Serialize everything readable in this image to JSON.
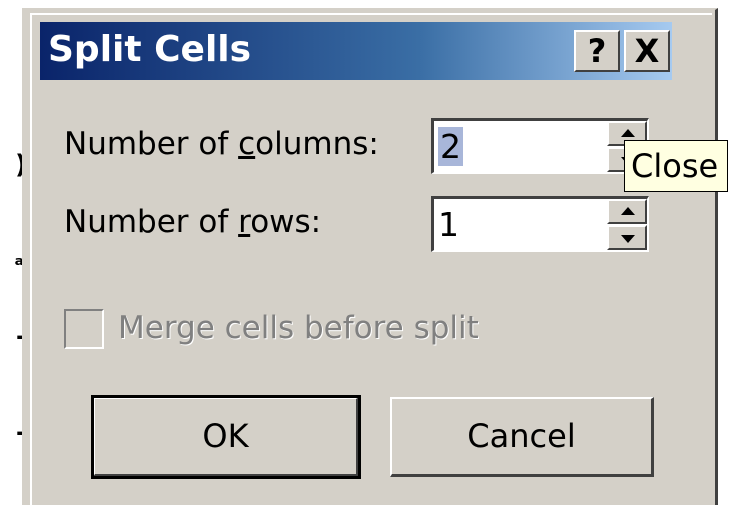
{
  "dialog": {
    "title": "Split Cells",
    "help_button_label": "?",
    "close_button_label": "X",
    "columns_label_pre": "Number of ",
    "columns_label_accel": "c",
    "columns_label_post": "olumns:",
    "columns_value": "2",
    "rows_label_pre": "Number of ",
    "rows_label_accel": "r",
    "rows_label_post": "ows:",
    "rows_value": "1",
    "merge_label": "Merge cells before split",
    "merge_checked": false,
    "ok_label": "OK",
    "cancel_label": "Cancel"
  },
  "tooltip": {
    "text": "Close"
  },
  "icons": {
    "help": "question-mark-icon",
    "close": "close-x-icon",
    "spin_up": "triangle-up-icon",
    "spin_down": "triangle-down-icon"
  },
  "colors": {
    "title_gradient_start": "#0a246a",
    "title_gradient_end": "#a6caf0",
    "dialog_face": "#d4d0c8",
    "tooltip_bg": "#ffffe1"
  }
}
